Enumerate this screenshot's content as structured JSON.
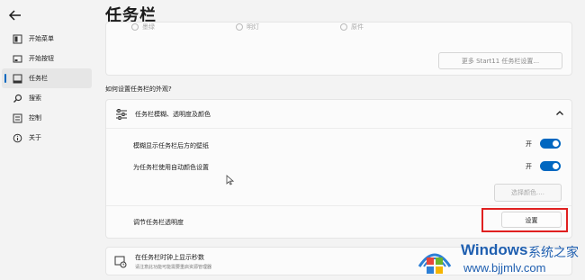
{
  "nav": {
    "items": [
      {
        "label": "开始菜单",
        "icon": "start-menu-icon"
      },
      {
        "label": "开始按钮",
        "icon": "start-button-icon"
      },
      {
        "label": "任务栏",
        "icon": "taskbar-icon"
      },
      {
        "label": "搜索",
        "icon": "search-icon"
      },
      {
        "label": "控制",
        "icon": "control-icon"
      },
      {
        "label": "关于",
        "icon": "info-icon"
      }
    ]
  },
  "page": {
    "title": "任务栏"
  },
  "top_card": {
    "radios": [
      "墨绿",
      "明灯",
      "原件"
    ],
    "more_button": "更多 Start11 任务栏设置..."
  },
  "appearance": {
    "section_label": "如何设置任务栏的外观?",
    "expander_title": "任务栏模糊、透明度及颜色",
    "blur_label": "模糊显示任务栏后方的壁纸",
    "blur_state": "开",
    "autocolor_label": "为任务栏使用自动颜色设置",
    "autocolor_state": "开",
    "choose_color_button": "选择颜色....",
    "transparency_label": "调节任务栏透明度",
    "settings_button": "设置"
  },
  "bottom_card": {
    "title": "在任务栏时钟上显示秒数",
    "subtitle": "请注意此功能可能需要重启资源管理器"
  },
  "watermark": {
    "brand": "Windows",
    "suffix": "系统之家",
    "url": "www.bjjmlv.com"
  },
  "colors": {
    "accent": "#0067c0",
    "highlight": "#e02020"
  }
}
